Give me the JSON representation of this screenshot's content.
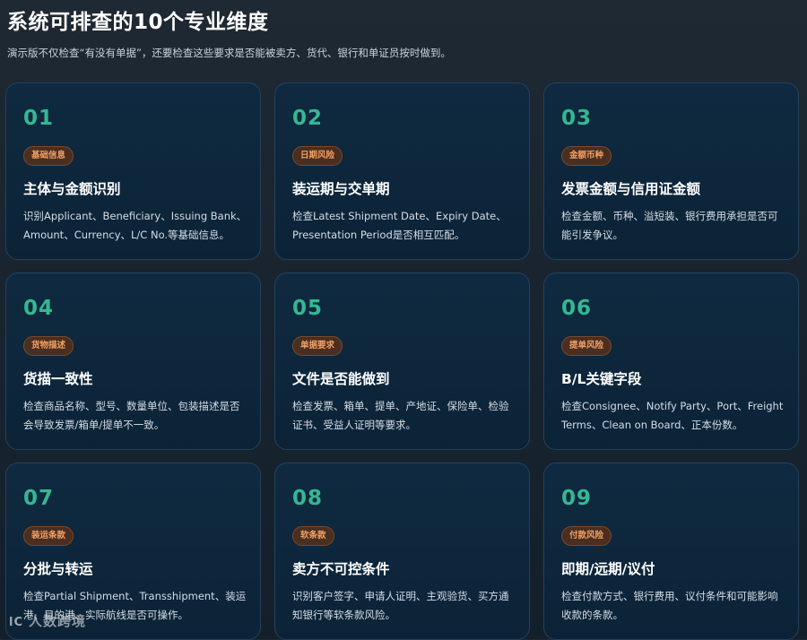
{
  "header": {
    "title": "系统可排查的10个专业维度",
    "subtitle": "演示版不仅检查“有没有单据”，还要检查这些要求是否能被卖方、货代、银行和单证员按时做到。"
  },
  "cards": [
    {
      "num": "01",
      "tag": "基础信息",
      "title": "主体与金额识别",
      "desc": "识别Applicant、Beneficiary、Issuing Bank、Amount、Currency、L/C No.等基础信息。"
    },
    {
      "num": "02",
      "tag": "日期风险",
      "title": "装运期与交单期",
      "desc": "检查Latest Shipment Date、Expiry Date、Presentation Period是否相互匹配。"
    },
    {
      "num": "03",
      "tag": "金额币种",
      "title": "发票金额与信用证金额",
      "desc": "检查金额、币种、溢短装、银行费用承担是否可能引发争议。"
    },
    {
      "num": "04",
      "tag": "货物描述",
      "title": "货描一致性",
      "desc": "检查商品名称、型号、数量单位、包装描述是否会导致发票/箱单/提单不一致。"
    },
    {
      "num": "05",
      "tag": "单据要求",
      "title": "文件是否能做到",
      "desc": "检查发票、箱单、提单、产地证、保险单、检验证书、受益人证明等要求。"
    },
    {
      "num": "06",
      "tag": "提单风险",
      "title": "B/L关键字段",
      "desc": "检查Consignee、Notify Party、Port、Freight Terms、Clean on Board、正本份数。"
    },
    {
      "num": "07",
      "tag": "装运条款",
      "title": "分批与转运",
      "desc": "检查Partial Shipment、Transshipment、装运港、目的港、实际航线是否可操作。"
    },
    {
      "num": "08",
      "tag": "软条款",
      "title": "卖方不可控条件",
      "desc": "识别客户签字、申请人证明、主观验货、买方通知银行等软条款风险。"
    },
    {
      "num": "09",
      "tag": "付款风险",
      "title": "即期/远期/议付",
      "desc": "检查付款方式、银行费用、议付条件和可能影响收款的条款。"
    }
  ],
  "watermark": {
    "logo": "lC",
    "text": "人数跨境"
  },
  "colors": {
    "accent_number": "#35b892",
    "tag_text": "#f1a165",
    "tag_bg": "#4a2e20",
    "card_bg": "#0f2a40",
    "page_bg": "#1f2933"
  }
}
